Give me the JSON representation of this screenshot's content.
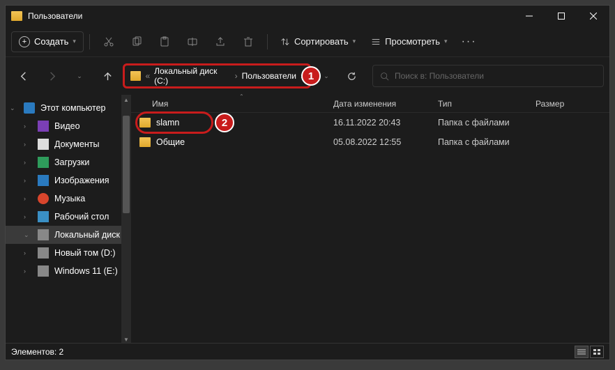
{
  "window": {
    "title": "Пользователи"
  },
  "toolbar": {
    "create": "Создать",
    "sort": "Сортировать",
    "view": "Просмотреть"
  },
  "breadcrumb": {
    "prefix": "«",
    "part1": "Локальный диск (C:)",
    "part2": "Пользователи"
  },
  "search": {
    "placeholder": "Поиск в: Пользователи"
  },
  "sidebar": {
    "root": "Этот компьютер",
    "items": [
      "Видео",
      "Документы",
      "Загрузки",
      "Изображения",
      "Музыка",
      "Рабочий стол",
      "Локальный диск",
      "Новый том (D:)",
      "Windows 11 (E:)"
    ]
  },
  "columns": {
    "name": "Имя",
    "date": "Дата изменения",
    "type": "Тип",
    "size": "Размер"
  },
  "rows": [
    {
      "name": "slamn",
      "date": "16.11.2022 20:43",
      "type": "Папка с файлами"
    },
    {
      "name": "Общие",
      "date": "05.08.2022 12:55",
      "type": "Папка с файлами"
    }
  ],
  "status": {
    "count": "Элементов: 2"
  },
  "badges": {
    "one": "1",
    "two": "2"
  }
}
